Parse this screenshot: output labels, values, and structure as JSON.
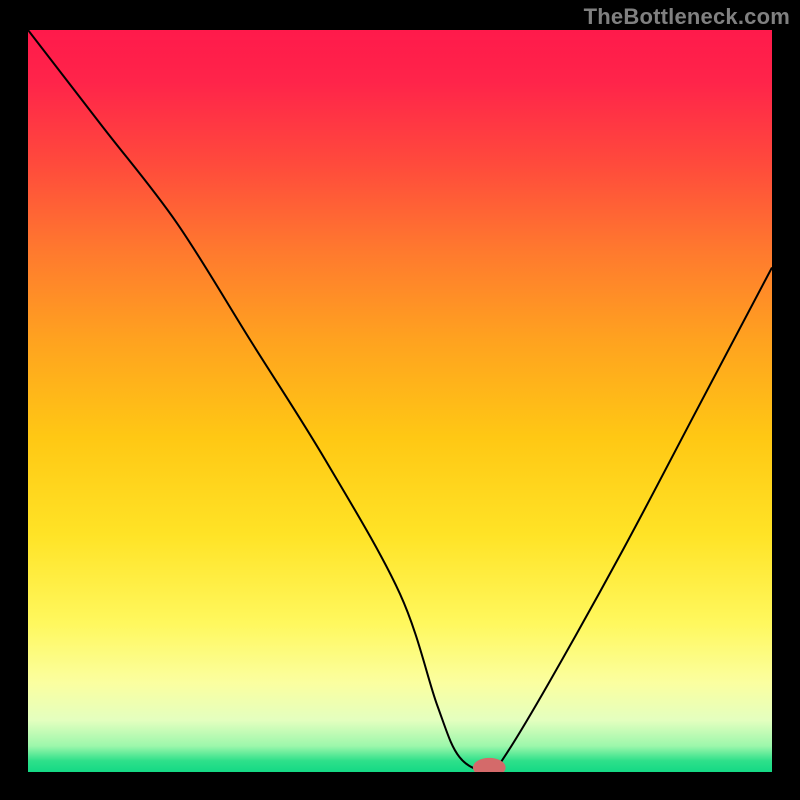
{
  "watermark": "TheBottleneck.com",
  "chart_data": {
    "type": "line",
    "title": "",
    "xlabel": "",
    "ylabel": "",
    "xlim": [
      0,
      100
    ],
    "ylim": [
      0,
      100
    ],
    "grid": false,
    "x": [
      0,
      10,
      20,
      30,
      40,
      50,
      55,
      58,
      62,
      64,
      70,
      80,
      90,
      100
    ],
    "values": [
      100,
      87,
      74,
      58,
      42,
      24,
      9,
      2,
      0,
      2,
      12,
      30,
      49,
      68
    ],
    "marker": {
      "x": 62,
      "y": 0,
      "color": "#d46a6a",
      "rx": 2.2,
      "ry": 1.3
    },
    "gradient_stops": [
      {
        "offset": 0.0,
        "color": "#ff1a4b"
      },
      {
        "offset": 0.07,
        "color": "#ff244a"
      },
      {
        "offset": 0.18,
        "color": "#ff4a3c"
      },
      {
        "offset": 0.3,
        "color": "#ff7a2e"
      },
      {
        "offset": 0.42,
        "color": "#ffa31f"
      },
      {
        "offset": 0.55,
        "color": "#ffc814"
      },
      {
        "offset": 0.68,
        "color": "#ffe326"
      },
      {
        "offset": 0.8,
        "color": "#fff85e"
      },
      {
        "offset": 0.88,
        "color": "#fbffa0"
      },
      {
        "offset": 0.93,
        "color": "#e4ffbf"
      },
      {
        "offset": 0.965,
        "color": "#9cf7ab"
      },
      {
        "offset": 0.985,
        "color": "#2ee08a"
      },
      {
        "offset": 1.0,
        "color": "#14d985"
      }
    ]
  }
}
